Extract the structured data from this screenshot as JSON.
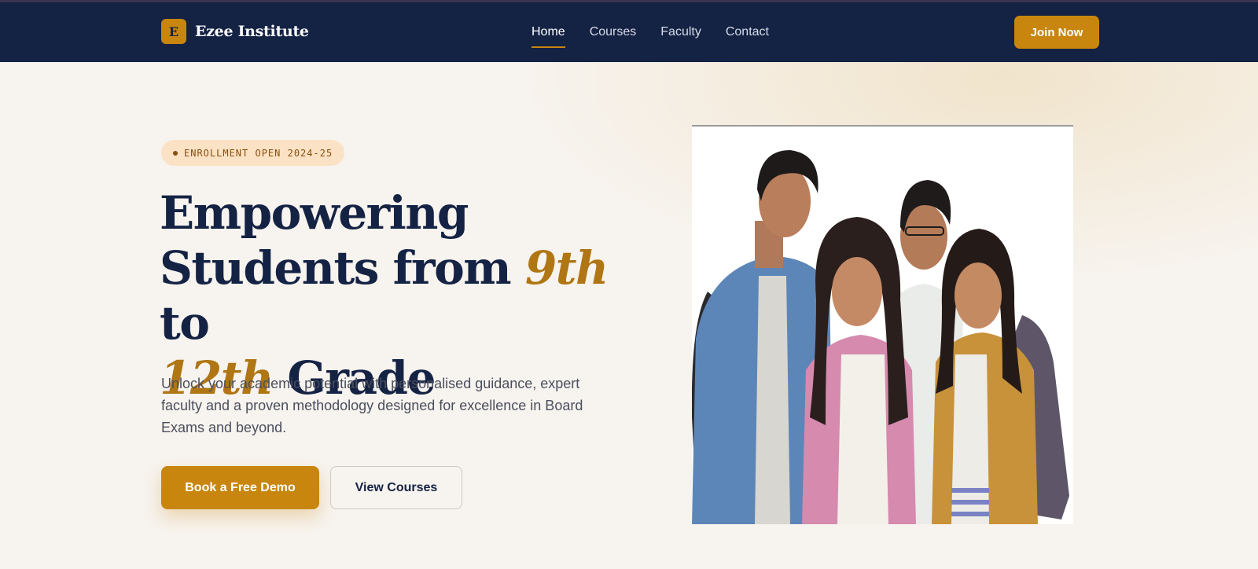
{
  "brand": {
    "logo_letter": "E",
    "name": "Ezee Institute"
  },
  "nav": {
    "items": [
      {
        "label": "Home",
        "active": true
      },
      {
        "label": "Courses",
        "active": false
      },
      {
        "label": "Faculty",
        "active": false
      },
      {
        "label": "Contact",
        "active": false
      }
    ],
    "cta_label": "Join Now"
  },
  "hero": {
    "badge_label": "ENROLLMENT OPEN 2024-25",
    "headline": {
      "part1": "Empowering",
      "part2": "Students from",
      "accent1": "9th",
      "part3": "to",
      "accent2": "12th",
      "part4": "Grade"
    },
    "lead": "Unlock your academic potential with personalised guidance, expert faculty and a proven methodology designed for excellence in Board Exams and beyond.",
    "primary_cta": "Book a Free Demo",
    "secondary_cta": "View Courses",
    "image_name": "students-group-photo"
  },
  "colors": {
    "navy": "#142244",
    "accent": "#c8860e",
    "accent_text": "#b07614",
    "background": "#f7f3ee",
    "badge_bg": "#fbe2c5"
  }
}
